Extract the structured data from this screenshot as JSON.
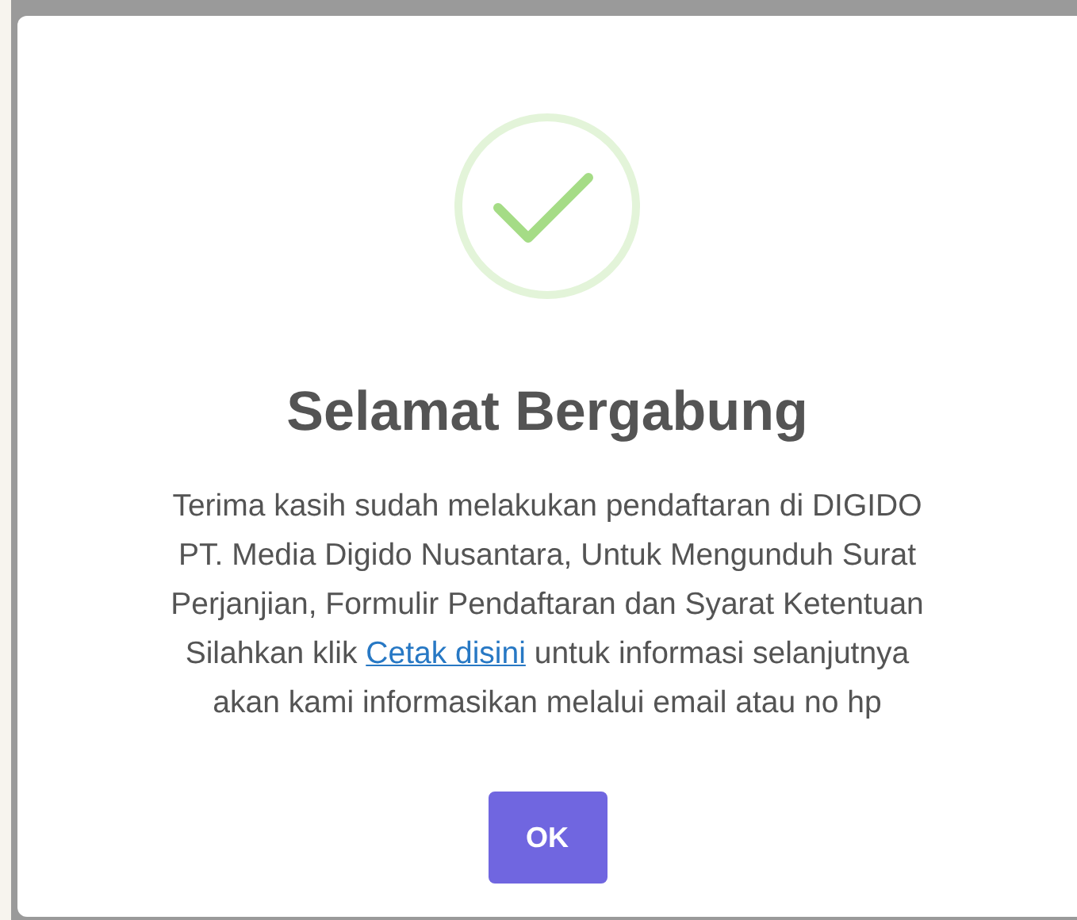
{
  "dialog": {
    "icon": {
      "kind": "success"
    },
    "title": "Selamat Bergabung",
    "message_lines": [
      {
        "kind": "text",
        "text": "Terima kasih sudah melakukan pendaftaran di DIGIDO"
      },
      {
        "kind": "text",
        "text": "PT. Media Digido Nusantara, Untuk Mengunduh Surat"
      },
      {
        "kind": "text",
        "text": "Perjanjian, Formulir Pendaftaran dan Syarat Ketentuan"
      },
      {
        "kind": "link",
        "before": "Silahkan klik ",
        "link": "Cetak disini",
        "after": " untuk informasi selanjutnya"
      },
      {
        "kind": "text",
        "text": "akan kami informasikan melalui email atau no hp"
      }
    ],
    "buttons": [
      "OK"
    ]
  }
}
